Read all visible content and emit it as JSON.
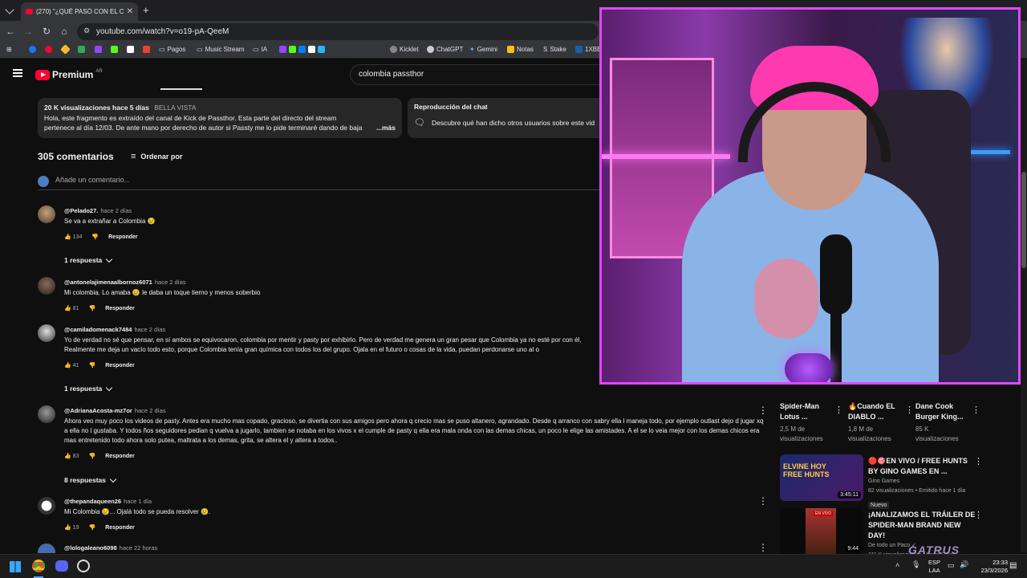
{
  "browser": {
    "tab_title": "(270) \"¿QUÉ PASÓ CON EL COL",
    "url": "youtube.com/watch?v=o19-pA-QeeM",
    "bookmarks": [
      "Pagos",
      "Music Stream",
      "IA",
      "Kicklet",
      "ChatGPT",
      "Gemini",
      "Notas",
      "Stake",
      "1XBE"
    ]
  },
  "youtube": {
    "logo": "Premium",
    "region": "AR",
    "search_value": "colombia passthor"
  },
  "description": {
    "meta": "20 K visualizaciones  hace 5 días",
    "location": "BELLA VISTA",
    "text": "Hola, este fragmento es extraído del canal de Kick de Passthor. Esta parte del directo del stream pertenece al día 12/03. De ante mano por derecho de autor si Passty me lo pide terminaré dando de baja el video. Lo subo",
    "more": "...más"
  },
  "chat_replay": {
    "title": "Reproducción del chat",
    "text": "Descubre qué han dicho otros usuarios sobre este vid"
  },
  "comments": {
    "count": "305 comentarios",
    "sort_label": "Ordenar por",
    "add_placeholder": "Añade un comentario...",
    "items": [
      {
        "author": "@Pelado27.",
        "time": "hace 2 días",
        "text": "Se va a extrañar a Colombia 😢",
        "likes": "134",
        "reply": "Responder",
        "replies": "1 respuesta"
      },
      {
        "author": "@antonelajimenaalbornoz6071",
        "time": "hace 2 días",
        "text": "Mi colombia.  Lo amaba 😢 le daba un toque tierno y menos soberbio",
        "likes": "81",
        "reply": "Responder",
        "replies": ""
      },
      {
        "author": "@camiladomenack7484",
        "time": "hace 2 días",
        "text": "Yo de verdad no sé que pensar, en sí ambos se equivocaron, colombia por mentir y pasty por exhibirlo. Pero de verdad me genera un gran pesar que Colombia ya no esté por con él. Realmente me deja un vacío todo esto, porque Colombia tenía gran química con todos los del grupo. Ojala en el futuro o cosas de la vida, puedan perdonarse uno al o",
        "likes": "41",
        "reply": "Responder",
        "replies": "1 respuesta"
      },
      {
        "author": "@AdrianaAcosta-mz7or",
        "time": "hace 2 días",
        "text": "Ahora veo muy poco los videos de pasty. Antes era mucho mas copado, gracioso, se divertia con sus amigos pero ahora q crecio mas se puso altanero, agrandado. Desde q arranco con sabry ella l maneja todo, por ejemplo outlast dejo d jugar xq a ella no l gustaba. Y todos ños seguidores pedian q vuelva a jugarlo, tambien se notaba en los vivos x el cumple de pasty q ella era mala onda con las demas chicas, un poco le elige las amistades. A el se lo veia mejor con los demas chicos era mas entretenido todo ahora solo putea, maltrata a los demas, grita, se altera el y altera a todos..",
        "likes": "83",
        "reply": "Responder",
        "replies": "8 respuestas"
      },
      {
        "author": "@thepandaqueen26",
        "time": "hace 1 día",
        "text": "Mi Colombia 😢... Ojalá todo se pueda resolver 😢.",
        "likes": "19",
        "reply": "Responder",
        "replies": ""
      },
      {
        "author": "@lologaleano6098",
        "time": "hace 22 horas",
        "text": "",
        "likes": "",
        "reply": "",
        "replies": ""
      }
    ]
  },
  "recommendations": {
    "row": [
      {
        "title": "Spider-Man Lotus ...",
        "views": "2,5 M de",
        "sub": "visualizaciones"
      },
      {
        "title": "🔥Cuando EL DIABLO ...",
        "views": "1,8 M de",
        "sub": "visualizaciones"
      },
      {
        "title": "Dane Cook Burger King...",
        "views": "85 K",
        "sub": "visualizaciones"
      }
    ],
    "list": [
      {
        "title": "🔴🎯EN VIVO / FREE HUNTS BY GINO GAMES EN ...",
        "channel": "Gino Games",
        "meta": "82 visualizaciones • Emitido hace 1 día",
        "badge": "Nuevo",
        "duration": "3:45:11",
        "thumb_text": "ELVINE HOY FREE HUNTS"
      },
      {
        "title": "¡ANALIZAMOS EL TRÁILER DE SPIDER-MAN BRAND NEW DAY!",
        "channel": "De todo un Paco ✓",
        "meta": "111 K visualizaciones • hace 5 días",
        "badge": "",
        "duration": "9:44",
        "thumb_text": "EN VIVO"
      }
    ]
  },
  "taskbar": {
    "lang": "ESP",
    "lang2": "LAA",
    "time": "23:33",
    "date": "23/3/2026",
    "watermark": "GATRUS"
  },
  "colors": {
    "accent": "#ff0033",
    "cam_border": "#e048ff"
  }
}
